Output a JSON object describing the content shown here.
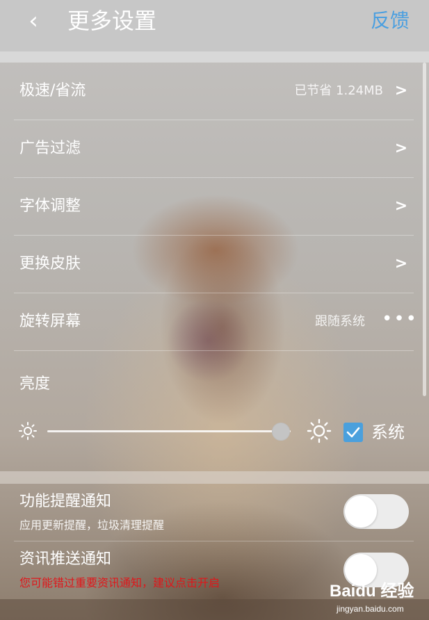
{
  "header": {
    "back_glyph": "‹",
    "title": "更多设置",
    "feedback_label": "反馈"
  },
  "settings": {
    "items": [
      {
        "label": "极速/省流",
        "value": "已节省 1.24MB",
        "indicator": "chevron-right-icon"
      },
      {
        "label": "广告过滤",
        "value": "",
        "indicator": "chevron-right-icon"
      },
      {
        "label": "字体调整",
        "value": "",
        "indicator": "chevron-right-icon"
      },
      {
        "label": "更换皮肤",
        "value": "",
        "indicator": "chevron-right-icon"
      },
      {
        "label": "旋转屏幕",
        "value": "跟随系统",
        "indicator": "more-dots-icon"
      }
    ]
  },
  "brightness": {
    "label": "亮度",
    "level_fraction": 0.96,
    "system_checked": true,
    "system_label": "系统"
  },
  "notifications": [
    {
      "title": "功能提醒通知",
      "subtitle": "应用更新提醒，垃圾清理提醒",
      "enabled": false
    },
    {
      "title": "资讯推送通知",
      "warning": "您可能错过重要资讯通知，建议点击开启",
      "enabled": false
    }
  ],
  "watermark": {
    "main": "Baidu 经验",
    "sub": "jingyan.baidu.com"
  },
  "colors": {
    "accent": "#4a9fe0",
    "warning": "#e0161a",
    "checkbox": "#4aa0dd"
  }
}
